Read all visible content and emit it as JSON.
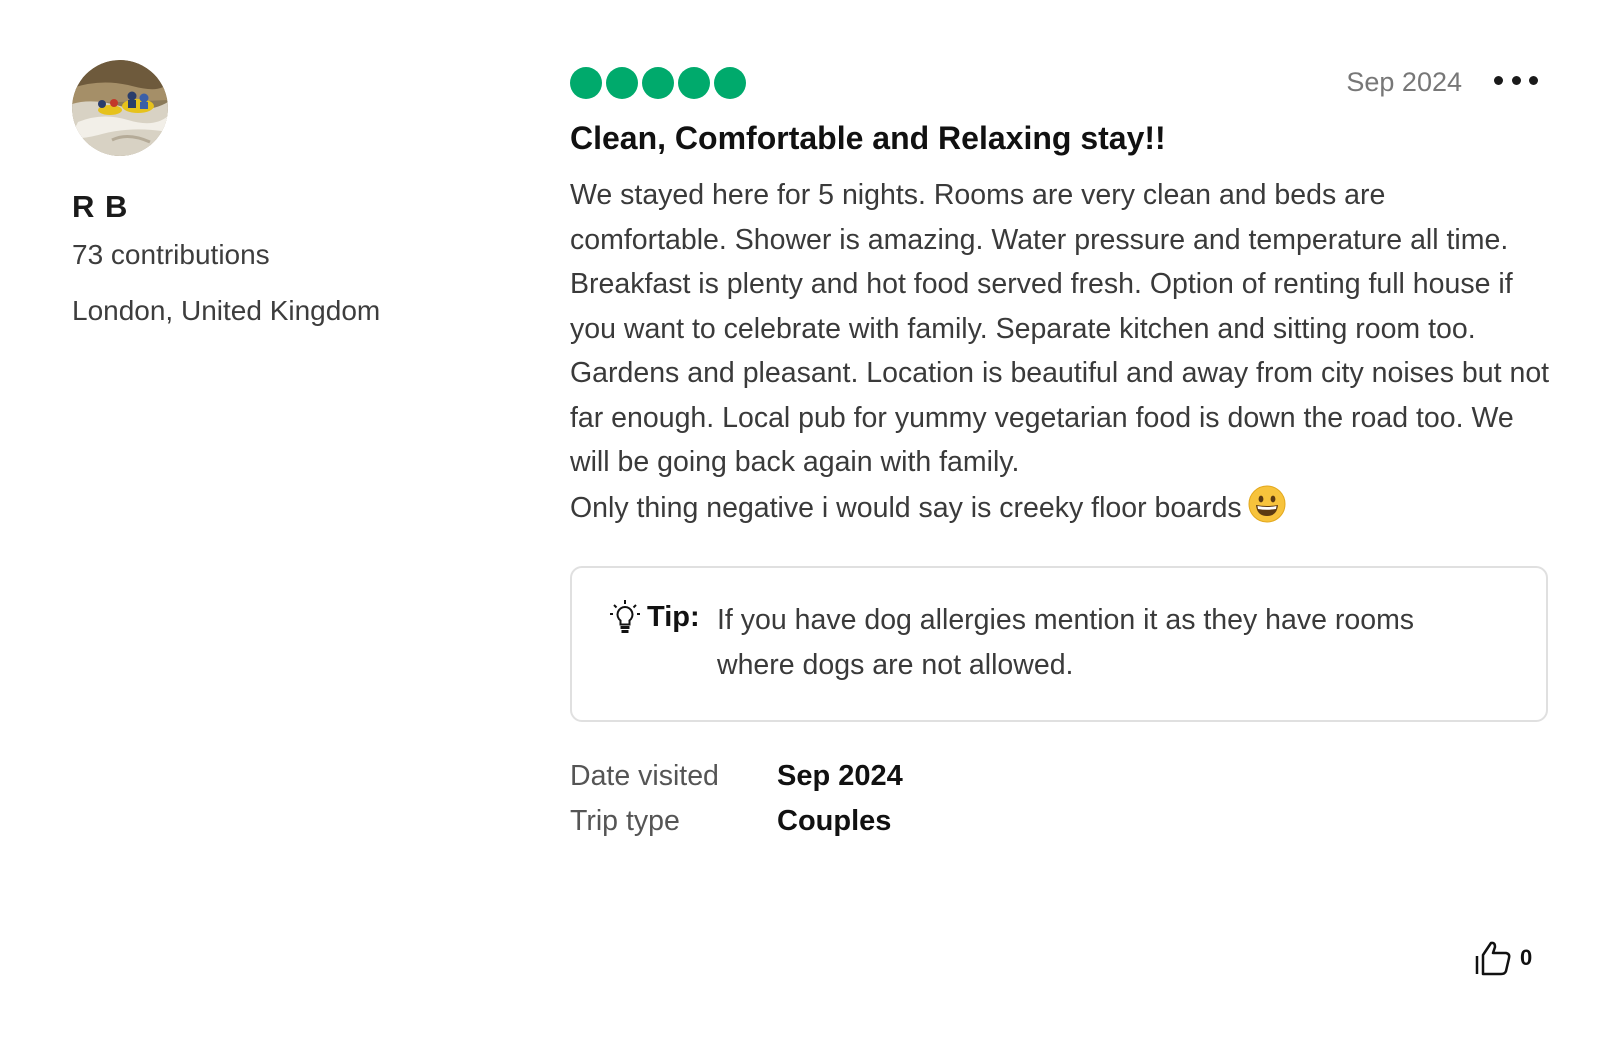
{
  "reviewer": {
    "name": "R B",
    "contributions": "73 contributions",
    "location": "London, United Kingdom",
    "avatar_icon": "avatar-rafting-photo"
  },
  "review": {
    "rating": 5,
    "rating_max": 5,
    "rating_color": "#00aa6c",
    "published_date": "Sep 2024",
    "more_icon": "ellipsis-icon",
    "title": "Clean, Comfortable and Relaxing stay!!",
    "body_paragraphs": [
      "We stayed here for 5 nights. Rooms are very clean and beds are comfortable. Shower is amazing. Water pressure and temperature all time. Breakfast is plenty and hot food served fresh. Option of renting full house if you want to celebrate with family. Separate kitchen and sitting room too. Gardens and pleasant. Location is beautiful and away from city noises but not far enough. Local pub for yummy vegetarian food is down the road too. We will be going back again with family.",
      "Only thing negative i would say is creeky floor boards"
    ],
    "emoji_icon": "grinning-face-emoji",
    "tip": {
      "icon": "lightbulb-icon",
      "label": "Tip:",
      "text": "If you have dog allergies mention it as they have rooms where dogs are not allowed."
    },
    "facts": [
      {
        "label": "Date visited",
        "value": "Sep 2024"
      },
      {
        "label": "Trip type",
        "value": "Couples"
      }
    ],
    "helpful": {
      "icon": "thumbs-up-icon",
      "count": "0"
    }
  }
}
